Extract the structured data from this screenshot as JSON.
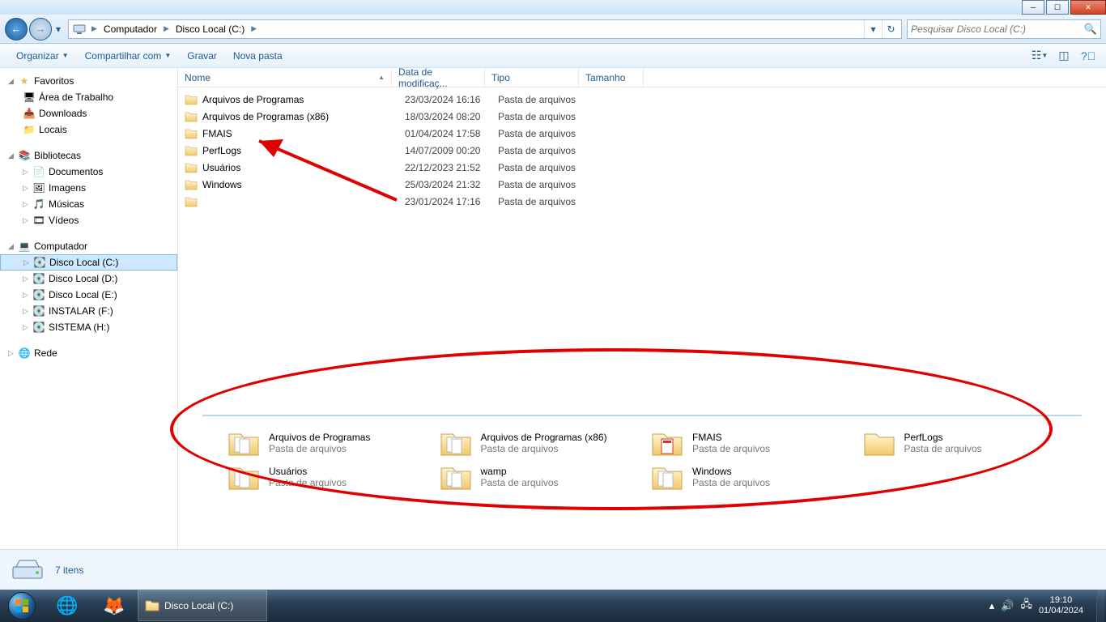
{
  "breadcrumb": {
    "root": "Computador",
    "seg2": "Disco Local (C:)"
  },
  "search": {
    "placeholder": "Pesquisar Disco Local (C:)"
  },
  "toolbar": {
    "organize": "Organizar",
    "share": "Compartilhar com",
    "burn": "Gravar",
    "newfolder": "Nova pasta"
  },
  "columns": {
    "nome": "Nome",
    "data": "Data de modificaç...",
    "tipo": "Tipo",
    "tamanho": "Tamanho"
  },
  "sidebar": {
    "favorites": "Favoritos",
    "fav": {
      "desktop": "Área de Trabalho",
      "downloads": "Downloads",
      "locais": "Locais"
    },
    "libraries": "Bibliotecas",
    "lib": {
      "docs": "Documentos",
      "img": "Imagens",
      "mus": "Músicas",
      "vid": "Vídeos"
    },
    "computer": "Computador",
    "drives": {
      "c": "Disco Local (C:)",
      "d": "Disco Local (D:)",
      "e": "Disco Local (E:)",
      "f": "INSTALAR (F:)",
      "h": "SISTEMA (H:)"
    },
    "network": "Rede"
  },
  "rows": [
    {
      "n": "Arquivos de Programas",
      "d": "23/03/2024 16:16",
      "t": "Pasta de arquivos"
    },
    {
      "n": "Arquivos de Programas (x86)",
      "d": "18/03/2024 08:20",
      "t": "Pasta de arquivos"
    },
    {
      "n": "FMAIS",
      "d": "01/04/2024 17:58",
      "t": "Pasta de arquivos"
    },
    {
      "n": "PerfLogs",
      "d": "14/07/2009 00:20",
      "t": "Pasta de arquivos"
    },
    {
      "n": "Usuários",
      "d": "22/12/2023 21:52",
      "t": "Pasta de arquivos"
    },
    {
      "n": "Windows",
      "d": "25/03/2024 21:32",
      "t": "Pasta de arquivos"
    },
    {
      "n": "",
      "d": "23/01/2024 17:16",
      "t": "Pasta de arquivos"
    }
  ],
  "preview": [
    {
      "n": "Arquivos de Programas",
      "s": "Pasta de arquivos"
    },
    {
      "n": "Arquivos de Programas (x86)",
      "s": "Pasta de arquivos"
    },
    {
      "n": "FMAIS",
      "s": "Pasta de arquivos"
    },
    {
      "n": "PerfLogs",
      "s": "Pasta de arquivos"
    },
    {
      "n": "Usuários",
      "s": "Pasta de arquivos"
    },
    {
      "n": "wamp",
      "s": "Pasta de arquivos"
    },
    {
      "n": "Windows",
      "s": "Pasta de arquivos"
    }
  ],
  "status": {
    "count": "7 itens"
  },
  "taskbar": {
    "active": "Disco Local (C:)"
  },
  "tray": {
    "time": "19:10",
    "date": "01/04/2024"
  }
}
